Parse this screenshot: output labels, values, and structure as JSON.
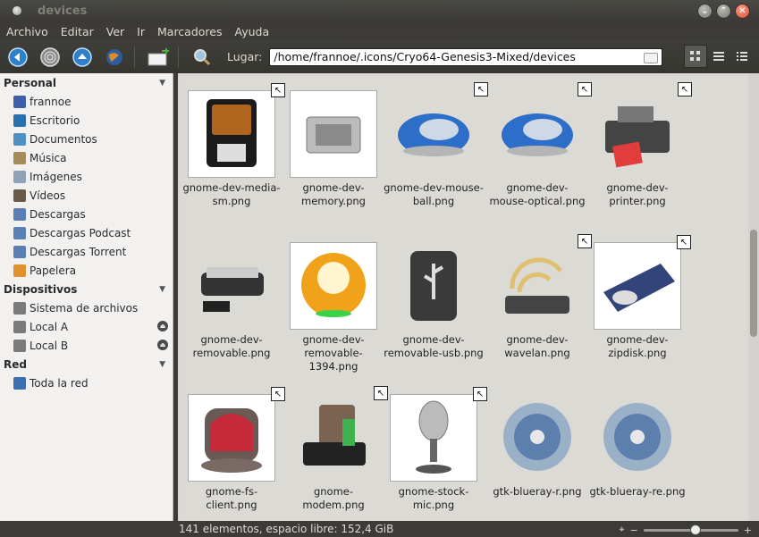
{
  "window": {
    "title": "devices"
  },
  "menu": [
    "Archivo",
    "Editar",
    "Ver",
    "Ir",
    "Marcadores",
    "Ayuda"
  ],
  "toolbar": {
    "location_label": "Lugar:",
    "location_value": "/home/frannoe/.icons/Cryo64-Genesis3-Mixed/devices"
  },
  "sidebar": {
    "personal": {
      "title": "Personal",
      "items": [
        {
          "label": "frannoe",
          "icon": "home-icon",
          "color": "#3d5fa8"
        },
        {
          "label": "Escritorio",
          "icon": "desktop-icon",
          "color": "#2a6fb0"
        },
        {
          "label": "Documentos",
          "icon": "documents-folder-icon",
          "color": "#4f8fc4"
        },
        {
          "label": "Música",
          "icon": "music-folder-icon",
          "color": "#a58b5a"
        },
        {
          "label": "Imágenes",
          "icon": "pictures-folder-icon",
          "color": "#8fa2b8"
        },
        {
          "label": "Vídeos",
          "icon": "videos-folder-icon",
          "color": "#6a5a4a"
        },
        {
          "label": "Descargas",
          "icon": "downloads-folder-icon",
          "color": "#5a7fb5"
        },
        {
          "label": "Descargas Podcast",
          "icon": "podcast-folder-icon",
          "color": "#5a7fb5"
        },
        {
          "label": "Descargas Torrent",
          "icon": "torrent-folder-icon",
          "color": "#5a7fb5"
        },
        {
          "label": "Papelera",
          "icon": "trash-icon",
          "color": "#e0902e"
        }
      ]
    },
    "devices": {
      "title": "Dispositivos",
      "items": [
        {
          "label": "Sistema de archivos",
          "icon": "filesystem-icon",
          "color": "#7a7a7a"
        },
        {
          "label": "Local A",
          "icon": "drive-icon",
          "color": "#7a7a7a"
        },
        {
          "label": "Local B",
          "icon": "drive-icon",
          "color": "#7a7a7a"
        }
      ]
    },
    "network": {
      "title": "Red",
      "items": [
        {
          "label": "Toda la red",
          "icon": "network-icon",
          "color": "#3d6fb0"
        }
      ]
    }
  },
  "files": [
    {
      "label": "gnome-dev-media-sm.png",
      "icon": "sd-card-icon",
      "link": true,
      "framed": true
    },
    {
      "label": "gnome-dev-memory.png",
      "icon": "memory-chip-icon",
      "link": false,
      "framed": true
    },
    {
      "label": "gnome-dev-mouse-ball.png",
      "icon": "mouse-icon",
      "link": true,
      "framed": false
    },
    {
      "label": "gnome-dev-mouse-optical.png",
      "icon": "mouse-icon",
      "link": true,
      "framed": false
    },
    {
      "label": "gnome-dev-printer.png",
      "icon": "printer-icon",
      "link": true,
      "framed": false
    },
    {
      "label": "gnome-dev-removable.png",
      "icon": "removable-drive-icon",
      "link": false,
      "framed": false
    },
    {
      "label": "gnome-dev-removable-1394.png",
      "icon": "firewire-drive-icon",
      "link": false,
      "framed": true
    },
    {
      "label": "gnome-dev-removable-usb.png",
      "icon": "usb-drive-icon",
      "link": false,
      "framed": false
    },
    {
      "label": "gnome-dev-wavelan.png",
      "icon": "wireless-icon",
      "link": true,
      "framed": false
    },
    {
      "label": "gnome-dev-zipdisk.png",
      "icon": "zipdisk-icon",
      "link": true,
      "framed": true
    },
    {
      "label": "gnome-fs-client.png",
      "icon": "fs-client-icon",
      "link": true,
      "framed": true
    },
    {
      "label": "gnome-modem.png",
      "icon": "modem-icon",
      "link": true,
      "framed": false
    },
    {
      "label": "gnome-stock-mic.png",
      "icon": "microphone-icon",
      "link": true,
      "framed": true
    },
    {
      "label": "gtk-blueray-r.png",
      "icon": "bluray-disc-icon",
      "link": false,
      "framed": false
    },
    {
      "label": "gtk-blueray-re.png",
      "icon": "bluray-disc-icon",
      "link": false,
      "framed": false
    }
  ],
  "status": {
    "text": "141 elementos, espacio libre: 152,4 GiB",
    "zoom_level": 0.55
  }
}
